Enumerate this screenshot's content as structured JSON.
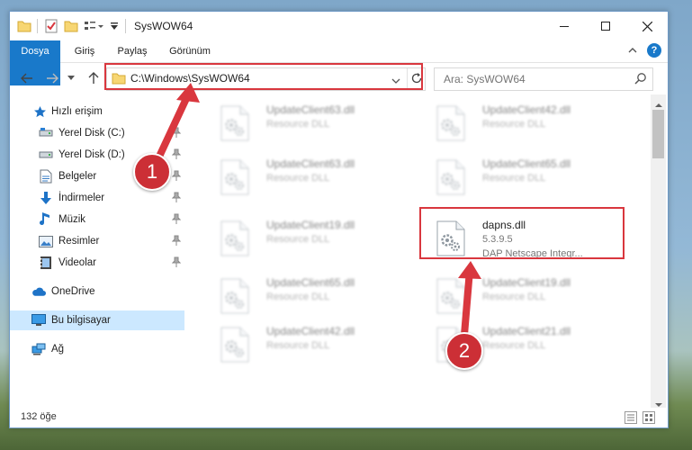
{
  "window": {
    "title": "SysWOW64",
    "minimize_icon": "minimize-icon",
    "maximize_icon": "maximize-icon",
    "close_icon": "close-icon"
  },
  "ribbon": {
    "tabs": [
      "Dosya",
      "Giriş",
      "Paylaş",
      "Görünüm"
    ]
  },
  "address": {
    "path": "C:\\Windows\\SysWOW64"
  },
  "search": {
    "placeholder": "Ara: SysWOW64"
  },
  "sidebar": {
    "items": [
      {
        "label": "Hızlı erişim",
        "icon": "star-icon"
      },
      {
        "label": "Yerel Disk (C:)",
        "icon": "drive-icon"
      },
      {
        "label": "Yerel Disk (D:)",
        "icon": "drive-icon"
      },
      {
        "label": "Belgeler",
        "icon": "documents-icon"
      },
      {
        "label": "İndirmeler",
        "icon": "download-icon"
      },
      {
        "label": "Müzik",
        "icon": "music-icon"
      },
      {
        "label": "Resimler",
        "icon": "pictures-icon"
      },
      {
        "label": "Videolar",
        "icon": "videos-icon"
      },
      {
        "label": "OneDrive",
        "icon": "cloud-icon"
      },
      {
        "label": "Bu bilgisayar",
        "icon": "computer-icon"
      },
      {
        "label": "Ağ",
        "icon": "network-icon"
      }
    ]
  },
  "files": [
    {
      "name": "UpdateClient63.dll",
      "type": "Resource DLL"
    },
    {
      "name": "UpdateClient42.dll",
      "type": "Resource DLL"
    },
    {
      "name": "UpdateClient63.dll",
      "type": "Resource DLL"
    },
    {
      "name": "UpdateClient65.dll",
      "type": "Resource DLL"
    },
    {
      "name": "UpdateClient19.dll",
      "type": "Resource DLL"
    },
    {
      "name": "dapns.dll",
      "version": "5.3.9.5",
      "description": "DAP Netscape Integr..."
    },
    {
      "name": "UpdateClient65.dll",
      "type": "Resource DLL"
    },
    {
      "name": "UpdateClient19.dll",
      "type": "Resource DLL"
    },
    {
      "name": "UpdateClient42.dll",
      "type": "Resource DLL"
    },
    {
      "name": "UpdateClient21.dll",
      "type": "Resource DLL"
    }
  ],
  "status": {
    "item_count": "132 öğe"
  },
  "annotations": {
    "step1": "1",
    "step2": "2",
    "color": "#d9373e"
  }
}
